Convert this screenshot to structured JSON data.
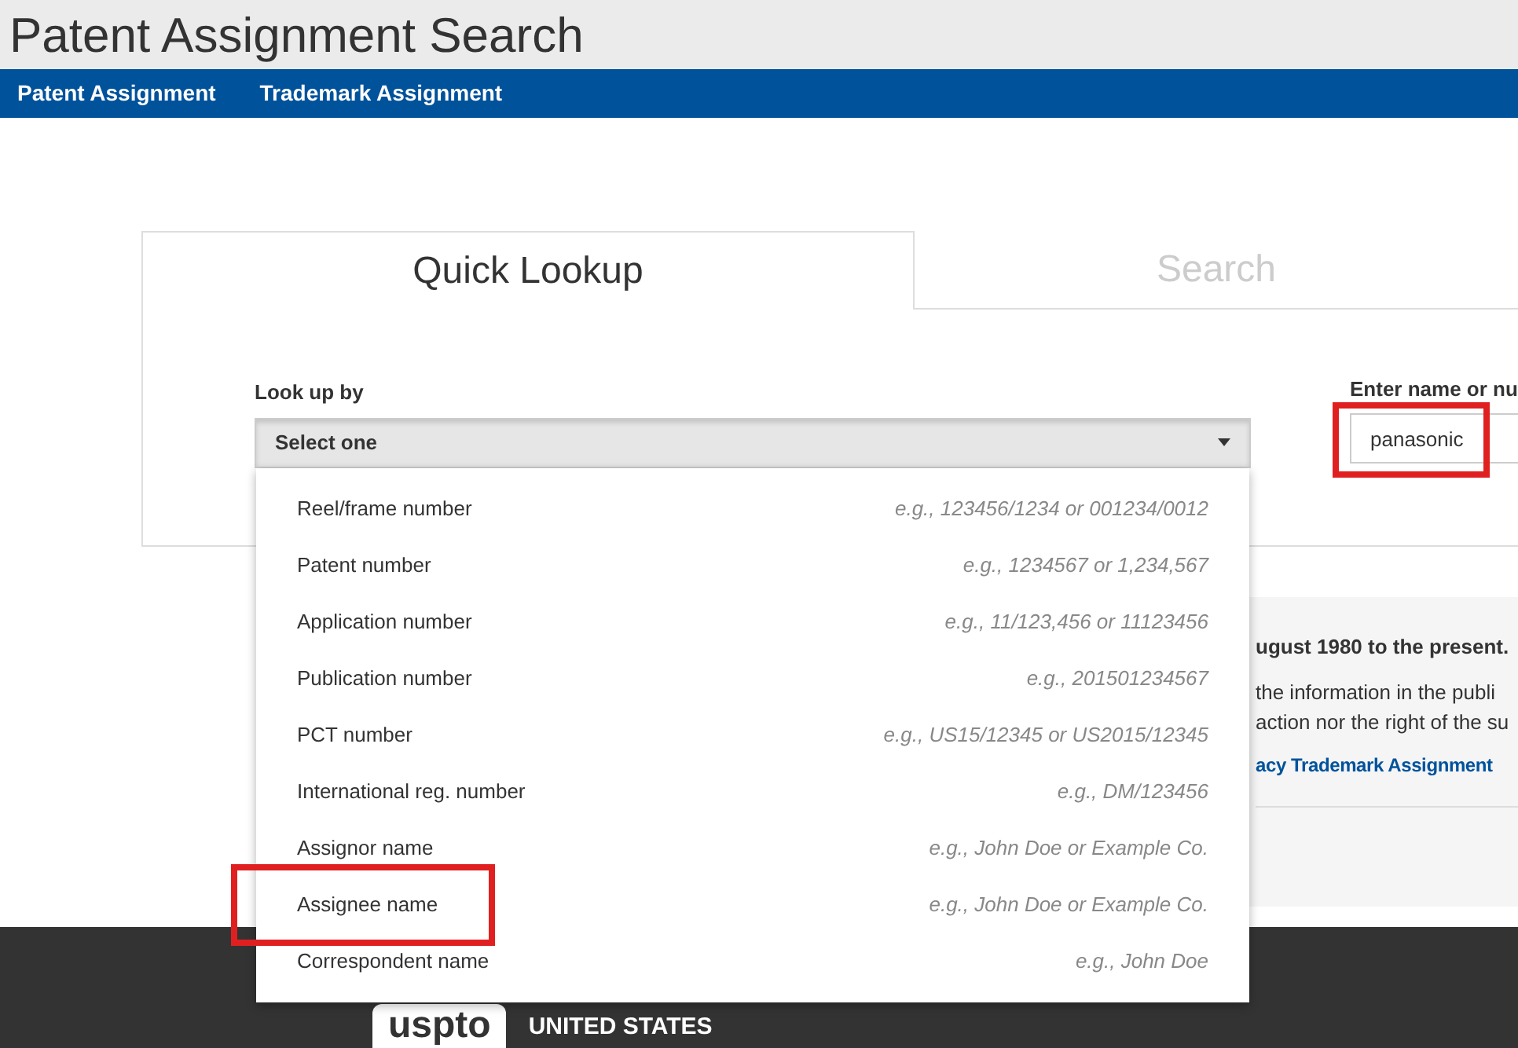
{
  "header": {
    "title": "Patent Assignment Search"
  },
  "nav": [
    {
      "label": "Patent Assignment"
    },
    {
      "label": "Trademark Assignment"
    }
  ],
  "tabs": [
    {
      "label": "Quick Lookup",
      "selected": true
    },
    {
      "label": "Search",
      "selected": false
    }
  ],
  "lookup": {
    "label": "Look up by",
    "select_value": "Select one",
    "expanded": true,
    "options": [
      {
        "label": "Reel/frame number",
        "example": "e.g., 123456/1234 or 001234/0012",
        "highlighted": false
      },
      {
        "label": "Patent number",
        "example": "e.g., 1234567 or 1,234,567",
        "highlighted": false
      },
      {
        "label": "Application number",
        "example": "e.g., 11/123,456 or 11123456",
        "highlighted": false
      },
      {
        "label": "Publication number",
        "example": "e.g., 201501234567",
        "highlighted": false
      },
      {
        "label": "PCT number",
        "example": "e.g., US15/12345 or US2015/12345",
        "highlighted": false
      },
      {
        "label": "International reg. number",
        "example": "e.g., DM/123456",
        "highlighted": false
      },
      {
        "label": "Assignor name",
        "example": "e.g., John Doe or Example Co.",
        "highlighted": false
      },
      {
        "label": "Assignee name",
        "example": "e.g., John Doe or Example Co.",
        "highlighted": true
      },
      {
        "label": "Correspondent name",
        "example": "e.g., John Doe",
        "highlighted": false
      }
    ]
  },
  "name_field": {
    "label": "Enter name or nu",
    "value": "panasonic",
    "highlighted": true
  },
  "info_panel": {
    "heading": "ugust 1980 to the present.",
    "lines": [
      "the information in the publi",
      "action nor the right of the su"
    ],
    "link": "acy Trademark Assignment"
  },
  "footer": {
    "logo": "uspto",
    "logo_caption": "UNITED STATES"
  }
}
